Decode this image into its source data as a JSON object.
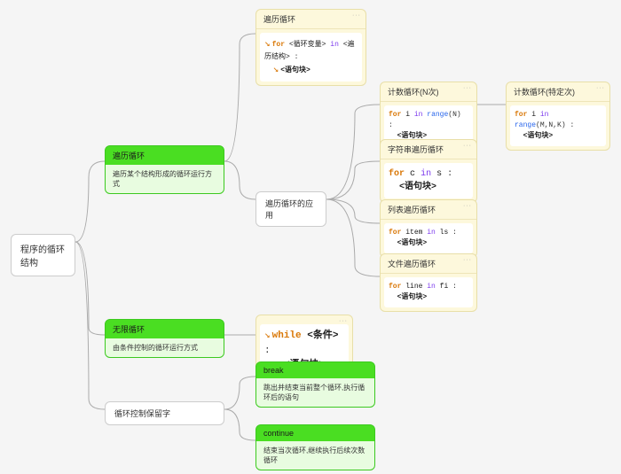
{
  "root": {
    "title": "程序的循环结构"
  },
  "branch1": {
    "title": "遍历循环",
    "subtitle": "遍历某个结构形成的循环运行方式"
  },
  "branch2": {
    "title": "无限循环",
    "subtitle": "由条件控制的循环运行方式"
  },
  "branch3": {
    "title": "循环控制保留字"
  },
  "b1_code": {
    "title": "遍历循环",
    "code": {
      "kw": "for",
      "var": "<循环变量>",
      "in": "in",
      "iter": "<遍历结构>",
      "colon": ":",
      "body": "<语句块>"
    }
  },
  "b1_apps_label": "遍历循环的应用",
  "app_count": {
    "title": "计数循环(N次)",
    "code": {
      "kw": "for",
      "var": "i",
      "in": "in",
      "fn": "range",
      "args": "(N)",
      "colon": ":",
      "body": "<语句块>"
    }
  },
  "app_count2": {
    "title": "计数循环(特定次)",
    "code": {
      "kw": "for",
      "var": "i",
      "in": "in",
      "fn": "range",
      "args": "(M,N,K)",
      "colon": ":",
      "body": "<语句块>"
    }
  },
  "app_str": {
    "title": "字符串遍历循环",
    "code": {
      "kw": "for",
      "var": "c",
      "in": "in",
      "iter": "s",
      "colon": ":",
      "body": "<语句块>"
    }
  },
  "app_list": {
    "title": "列表遍历循环",
    "code": {
      "kw": "for",
      "var": "item",
      "in": "in",
      "iter": "ls",
      "colon": ":",
      "body": "<语句块>"
    }
  },
  "app_file": {
    "title": "文件遍历循环",
    "code": {
      "kw": "for",
      "var": "line",
      "in": "in",
      "iter": "fi",
      "colon": ":",
      "body": "<语句块>"
    }
  },
  "b2_code": {
    "code": {
      "kw": "while",
      "cond": "<条件>",
      "colon": ":",
      "body": "<语句块>"
    }
  },
  "b3_break": {
    "title": "break",
    "subtitle": "跳出并结束当前整个循环,执行循环后的语句"
  },
  "b3_continue": {
    "title": "continue",
    "subtitle": "结束当次循环,继续执行后续次数循环"
  }
}
